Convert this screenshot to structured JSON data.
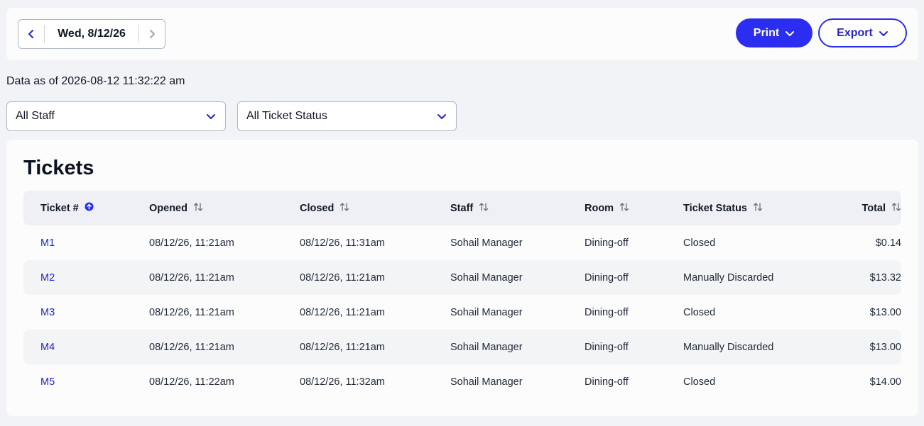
{
  "date_nav": {
    "label": "Wed, 8/12/26",
    "prev_icon": "chevron-left-icon",
    "next_icon": "chevron-right-icon"
  },
  "actions": {
    "print_label": "Print",
    "export_label": "Export"
  },
  "data_as_of": "Data as of 2026-08-12 11:32:22 am",
  "filters": {
    "staff": "All Staff",
    "status": "All Ticket Status"
  },
  "tickets": {
    "title": "Tickets",
    "columns": [
      "Ticket #",
      "Opened",
      "Closed",
      "Staff",
      "Room",
      "Ticket Status",
      "Total"
    ],
    "rows": [
      [
        "M1",
        "08/12/26, 11:21am",
        "08/12/26, 11:31am",
        "Sohail Manager",
        "Dining-off",
        "Closed",
        "$0.14"
      ],
      [
        "M2",
        "08/12/26, 11:21am",
        "08/12/26, 11:21am",
        "Sohail Manager",
        "Dining-off",
        "Manually Discarded",
        "$13.32"
      ],
      [
        "M3",
        "08/12/26, 11:21am",
        "08/12/26, 11:21am",
        "Sohail Manager",
        "Dining-off",
        "Closed",
        "$13.00"
      ],
      [
        "M4",
        "08/12/26, 11:21am",
        "08/12/26, 11:21am",
        "Sohail Manager",
        "Dining-off",
        "Manually Discarded",
        "$13.00"
      ],
      [
        "M5",
        "08/12/26, 11:22am",
        "08/12/26, 11:32am",
        "Sohail Manager",
        "Dining-off",
        "Closed",
        "$14.00"
      ]
    ]
  },
  "colors": {
    "accent": "#2b2ef0",
    "link": "#2325c8",
    "background": "#f2f3f7"
  }
}
